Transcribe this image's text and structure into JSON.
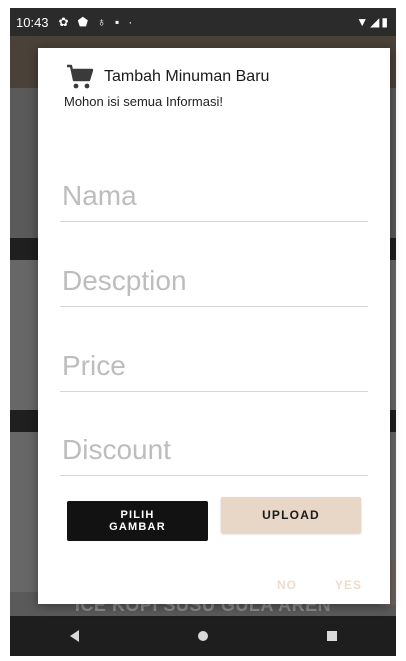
{
  "status_bar": {
    "time": "10:43",
    "icons": [
      "gear-icon",
      "shield-icon",
      "accessibility-icon",
      "sd-card-icon",
      "dot-icon"
    ],
    "right_icons": [
      "wifi-icon",
      "signal-icon",
      "battery-icon"
    ]
  },
  "background": {
    "caption": "ICE KOPI SUSU GULA AREN"
  },
  "dialog": {
    "title": "Tambah Minuman Baru",
    "message": "Mohon isi semua Informasi!",
    "fields": {
      "name_placeholder": "Nama",
      "description_placeholder": "Descption",
      "price_placeholder": "Price",
      "discount_placeholder": "Discount"
    },
    "pick_image_line1": "PILIH",
    "pick_image_line2": "GAMBAR",
    "upload_label": "UPLOAD",
    "no_label": "NO",
    "yes_label": "YES"
  },
  "colors": {
    "accent": "#e8d6c6",
    "dark_button": "#121212",
    "dim_action_text": "#ecdccd"
  }
}
